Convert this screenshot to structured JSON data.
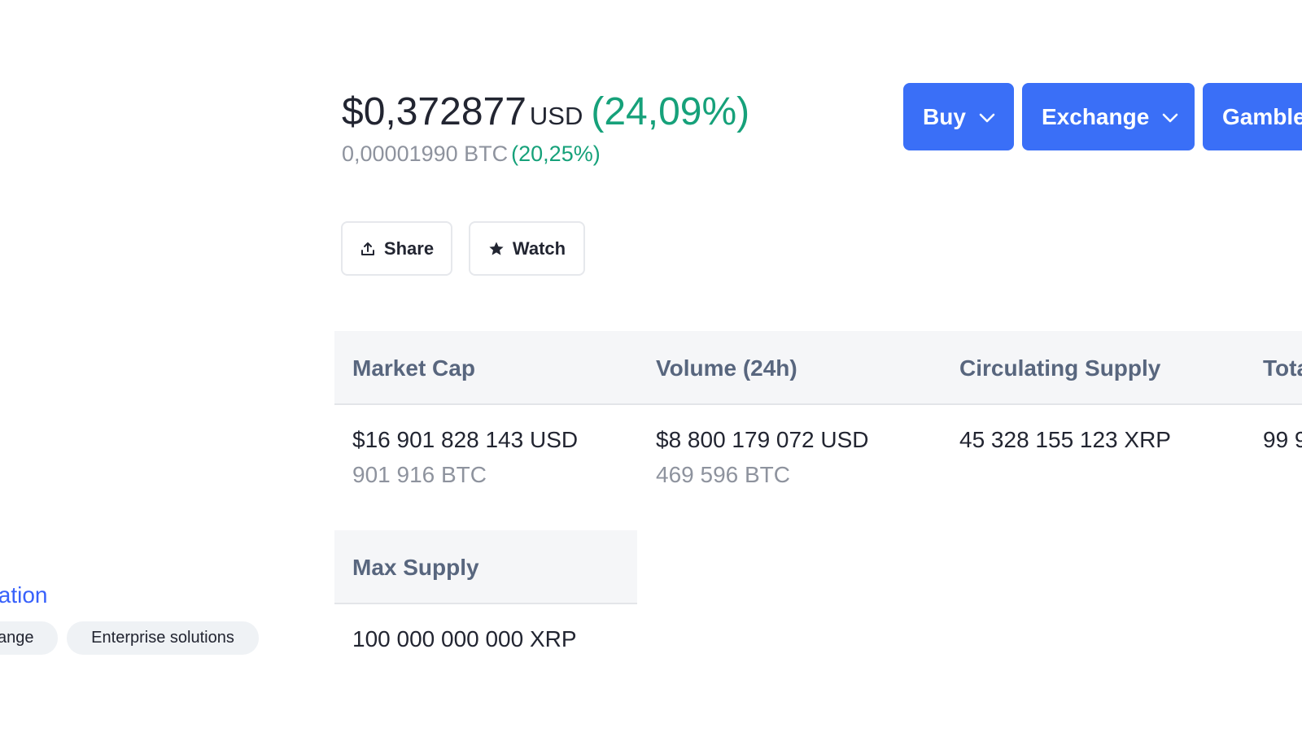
{
  "price": {
    "usd_value": "$0,372877",
    "currency": "USD",
    "usd_change": "(24,09%)",
    "btc_value": "0,00001990 BTC",
    "btc_change": "(20,25%)"
  },
  "actions": {
    "buy_label": "Buy",
    "exchange_label": "Exchange",
    "gamble_label": "Gamble",
    "share_label": "Share",
    "watch_label": "Watch"
  },
  "stats": {
    "headers": [
      "Market Cap",
      "Volume (24h)",
      "Circulating Supply",
      "Tota"
    ],
    "market_cap": {
      "value": "$16 901 828 143 USD",
      "sub": "901 916 BTC"
    },
    "volume": {
      "value": "$8 800 179 072 USD",
      "sub": "469 596 BTC"
    },
    "circulating": {
      "value": "45 328 155 123 XRP"
    },
    "total": {
      "value": "99 9"
    },
    "max_supply": {
      "label": "Max Supply",
      "value": "100 000 000 000 XRP"
    }
  },
  "sidebar": {
    "link_label": "tation",
    "tags": [
      "ange",
      "Enterprise solutions"
    ]
  },
  "colors": {
    "accent_blue": "#3a6ff7",
    "positive_green": "#16a17a",
    "muted_grey": "#8e939e",
    "link_blue": "#3861fb"
  },
  "icons": {
    "dropdown": "chevron-down-icon",
    "share": "share-upload-icon",
    "watch": "star-icon"
  }
}
